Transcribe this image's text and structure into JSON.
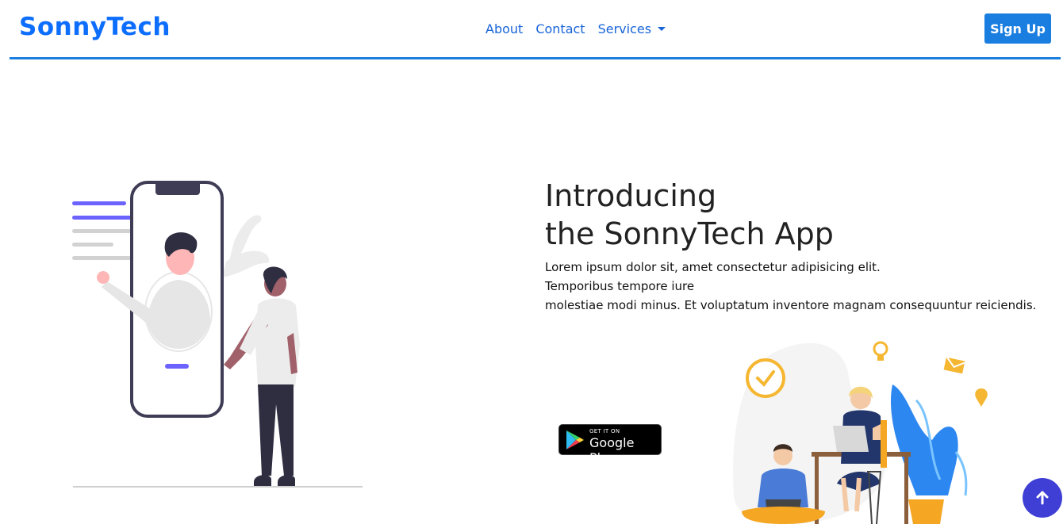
{
  "brand": "SonnyTech",
  "nav": {
    "about": "About",
    "contact": "Contact",
    "services": "Services"
  },
  "signup_label": "Sign Up",
  "hero": {
    "headline_line1": "Introducing",
    "headline_line2": "the SonnyTech App",
    "body_line1": "Lorem ipsum dolor sit, amet consectetur adipisicing elit.",
    "body_line2": "Temporibus tempore iure",
    "body_line3": "molestiae modi minus. Et voluptatum inventore magnam consequuntur reiciendis."
  },
  "google_play": {
    "small": "GET IT ON",
    "big": "Google Play"
  },
  "colors": {
    "accent": "#1a7ee0",
    "brand": "#0d6efd",
    "illustration_purple": "#6c63ff",
    "scroll_button": "#3f3fd6"
  },
  "icons": {
    "services_dropdown": "caret-down-icon",
    "scroll_top": "arrow-up-icon"
  }
}
